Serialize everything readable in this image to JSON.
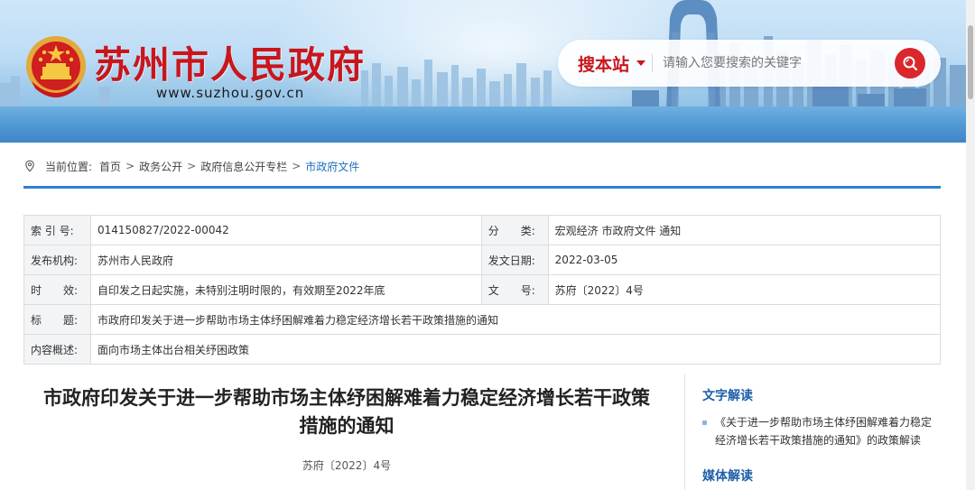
{
  "header": {
    "site_title": "苏州市人民政府",
    "site_url": "www.suzhou.gov.cn",
    "search": {
      "scope_label": "搜本站",
      "placeholder": "请输入您要搜索的关键字",
      "icon": "search-icon"
    },
    "emblem_icon": "national-emblem",
    "colors": {
      "brand_red": "#c8161d",
      "search_button": "#d9272c"
    }
  },
  "breadcrumb": {
    "prefix": "当前位置:",
    "items": [
      "首页",
      "政务公开",
      "政府信息公开专栏",
      "市政府文件"
    ],
    "separator": ">",
    "icon": "location-pin-icon"
  },
  "info_table": {
    "rows": [
      {
        "k1": "索 引 号:",
        "v1": "014150827/2022-00042",
        "k2": "分　　类:",
        "v2": "宏观经济 市政府文件 通知"
      },
      {
        "k1": "发布机构:",
        "v1": "苏州市人民政府",
        "k2": "发文日期:",
        "v2": "2022-03-05"
      },
      {
        "k1": "时　　效:",
        "v1": "自印发之日起实施，未特别注明时限的，有效期至2022年底",
        "k2": "文　　号:",
        "v2": "苏府〔2022〕4号"
      }
    ],
    "title_label": "标　　题:",
    "title_value": "市政府印发关于进一步帮助市场主体纾困解难着力稳定经济增长若干政策措施的通知",
    "summary_label": "内容概述:",
    "summary_value": "面向市场主体出台相关纾困政策"
  },
  "article": {
    "title_line1": "市政府印发关于进一步帮助市场主体纾困解难着力稳定经济增长若干政策",
    "title_line2": "措施的通知",
    "doc_number": "苏府〔2022〕4号"
  },
  "sidebar": {
    "text_interp_heading": "文字解读",
    "text_interp_link": "《关于进一步帮助市场主体纾困解难着力稳定经济增长若干政策措施的通知》的政策解读",
    "media_interp_heading": "媒体解读"
  }
}
